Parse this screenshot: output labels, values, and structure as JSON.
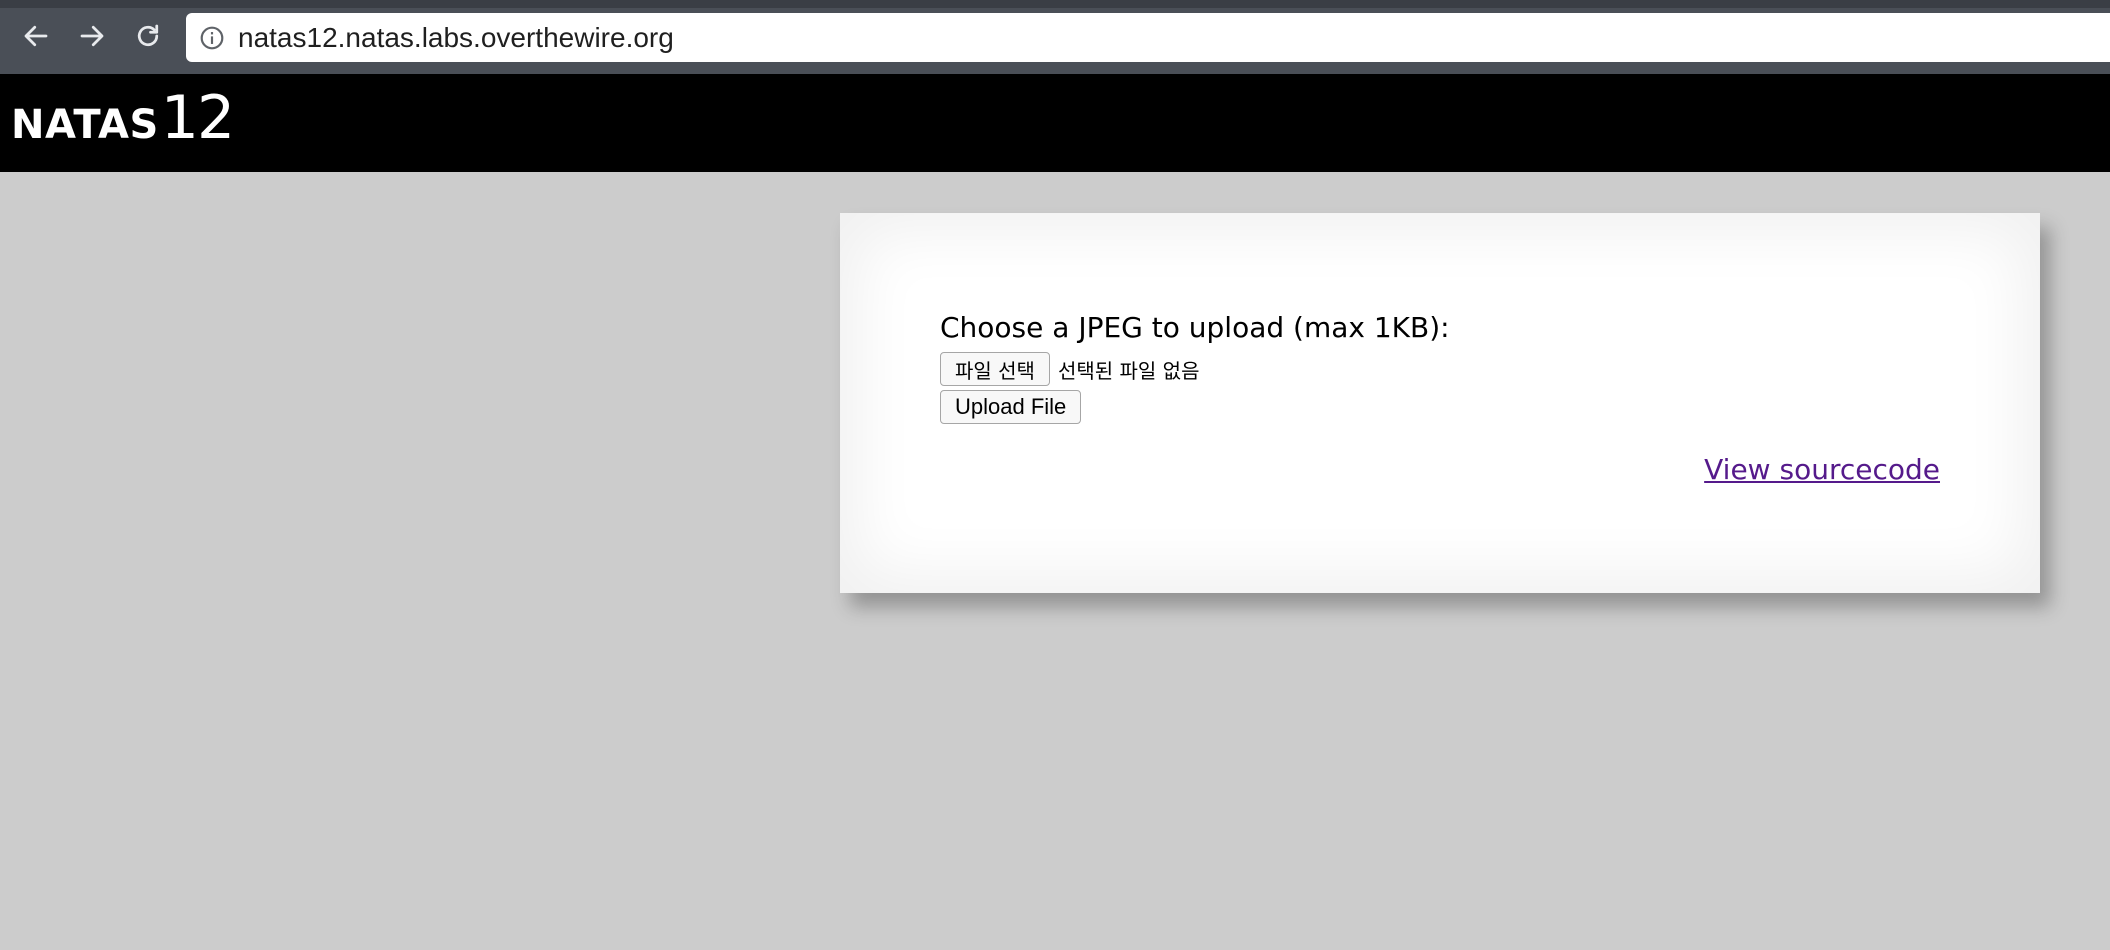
{
  "browser": {
    "url": "natas12.natas.labs.overthewire.org",
    "icons": {
      "back": "arrow-left-icon",
      "forward": "arrow-right-icon",
      "reload": "reload-icon",
      "site_info": "info-icon"
    }
  },
  "header": {
    "logo_name": "NATAS",
    "logo_level": "12"
  },
  "form": {
    "label": "Choose a JPEG to upload (max 1KB):",
    "choose_button": "파일 선택",
    "no_file_text": "선택된 파일 없음",
    "upload_button": "Upload File"
  },
  "links": {
    "view_source": "View sourcecode"
  },
  "colors": {
    "page_bg": "#cccccc",
    "header_bg": "#000000",
    "chrome_bg": "#4a4f57",
    "visited_link": "#551a8b"
  }
}
